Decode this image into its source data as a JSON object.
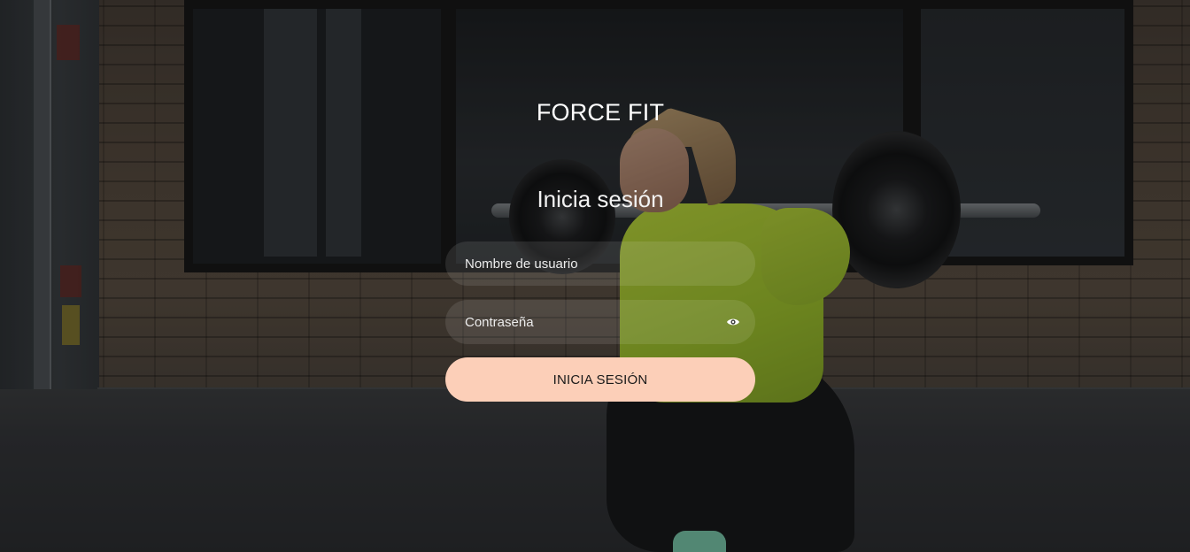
{
  "brand": {
    "name": "FORCE FIT"
  },
  "login": {
    "heading": "Inicia sesión",
    "username_placeholder": "Nombre de usuario",
    "username_value": "",
    "password_placeholder": "Contraseña",
    "password_value": "",
    "password_toggle_icon": "eye-icon",
    "submit_label": "INICIA SESIÓN"
  },
  "colors": {
    "submit_background": "#fccfb8",
    "text": "#ffffff",
    "field_background": "rgba(255,255,255,0.10)"
  }
}
